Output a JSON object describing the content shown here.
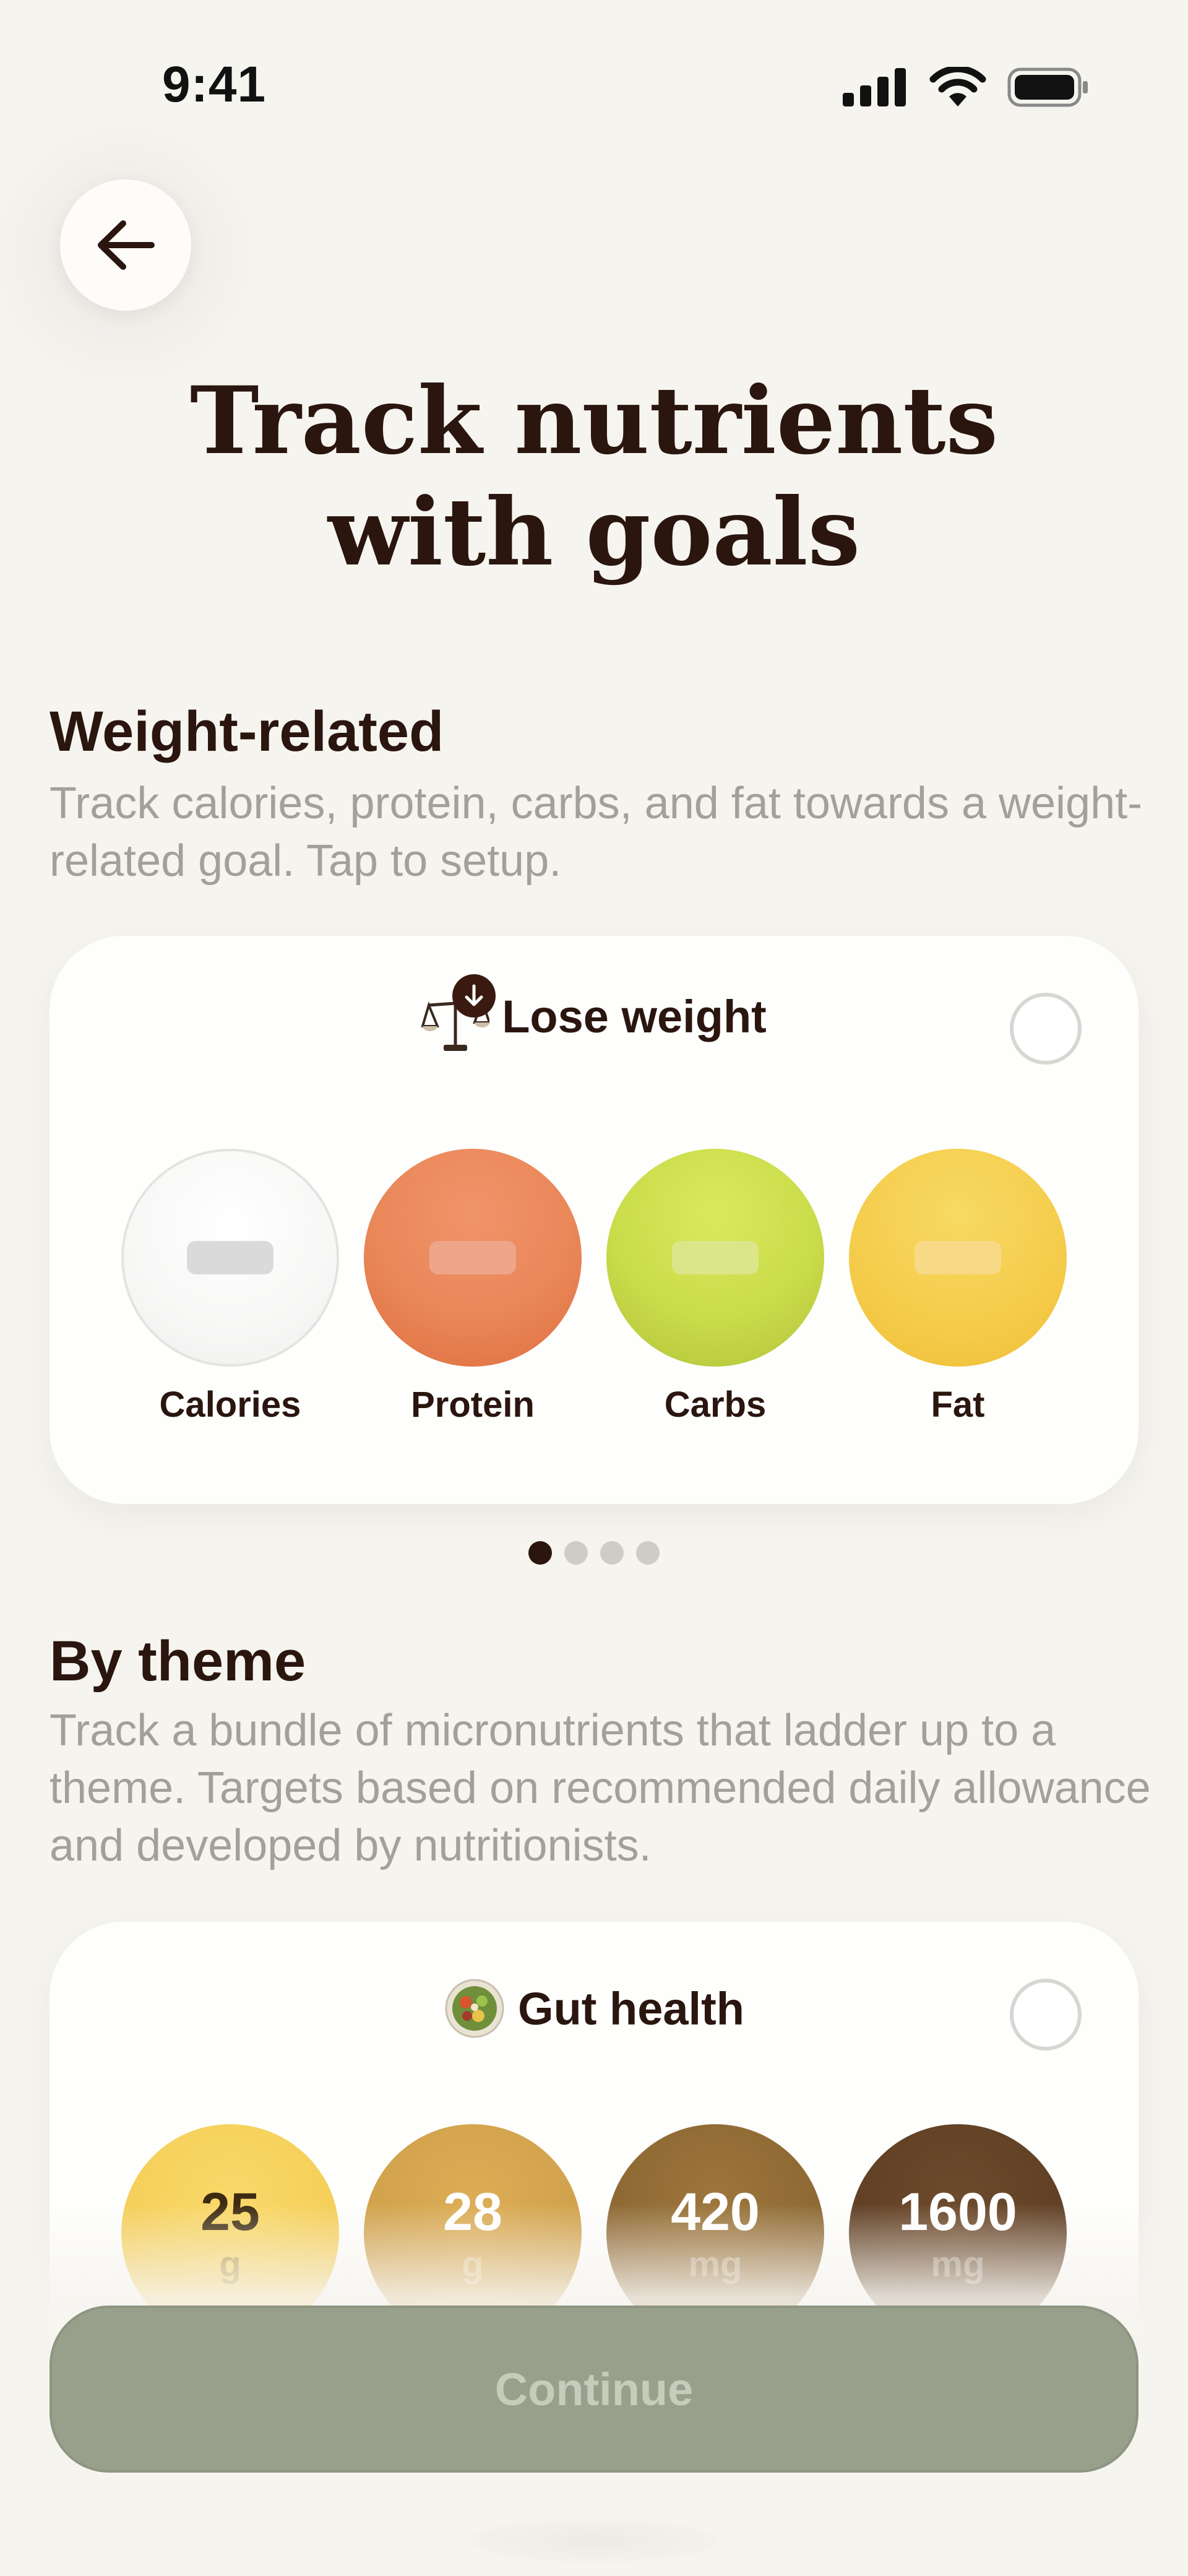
{
  "status_bar": {
    "time": "9:41"
  },
  "header": {
    "back_icon": "arrow-left-icon",
    "title_line1": "Track nutrients",
    "title_line2": "with goals"
  },
  "weight_section": {
    "heading": "Weight-related",
    "description": "Track calories, protein, carbs, and fat towards a weight-related goal. Tap to setup.",
    "card": {
      "icon": "scale-icon",
      "title": "Lose weight",
      "selected": false,
      "nutrients": [
        {
          "label": "Calories",
          "color": "#f4f4f3"
        },
        {
          "label": "Protein",
          "color": "#e98758"
        },
        {
          "label": "Carbs",
          "color": "#c9dc4a"
        },
        {
          "label": "Fat",
          "color": "#f5cd4d"
        }
      ]
    },
    "pager": {
      "count": 4,
      "active_index": 0
    }
  },
  "theme_section": {
    "heading": "By theme",
    "description": "Track a bundle of micronutrients that ladder up to a theme. Targets based on recommended daily allowance and developed by nutritionists.",
    "card": {
      "icon": "salad-bowl-icon",
      "title": "Gut health",
      "selected": false,
      "values": [
        {
          "value": "25",
          "unit": "g",
          "color": "#f4cd56"
        },
        {
          "value": "28",
          "unit": "g",
          "color": "#cfa04a"
        },
        {
          "value": "420",
          "unit": "mg",
          "color": "#8c6632"
        },
        {
          "value": "1600",
          "unit": "mg",
          "color": "#5e3e23"
        }
      ]
    }
  },
  "footer": {
    "continue_label": "Continue",
    "continue_enabled": false
  },
  "colors": {
    "background": "#f6f4ef",
    "text_primary": "#2a160f",
    "text_secondary": "#a3a09b",
    "button_disabled": "#98a08b"
  }
}
